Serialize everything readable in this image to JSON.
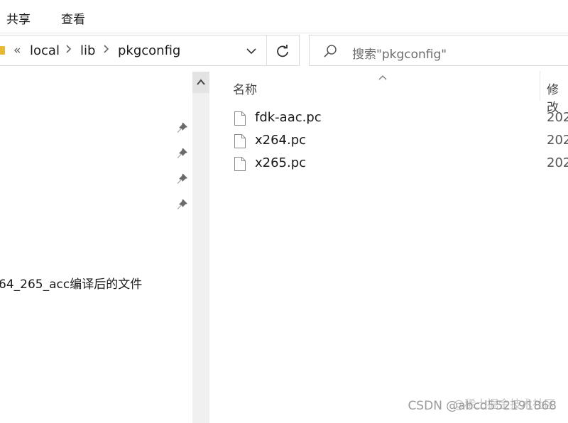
{
  "ribbon": {
    "tabs": [
      "共享",
      "查看"
    ]
  },
  "address_bar": {
    "overflow": "«",
    "breadcrumbs": [
      "local",
      "lib",
      "pkgconfig"
    ],
    "icons": [
      "folder-icon",
      "chevron-right-icon",
      "chevron-down-icon",
      "refresh-icon"
    ]
  },
  "search": {
    "placeholder": "搜索\"pkgconfig\"",
    "icon": "search-icon"
  },
  "nav_pane": {
    "pinned_count": 4,
    "item_text": "64_265_acc编译后的文件"
  },
  "columns": {
    "name": "名称",
    "modified": "修改"
  },
  "files": [
    {
      "name": "fdk-aac.pc",
      "date": "202"
    },
    {
      "name": "x264.pc",
      "date": "202"
    },
    {
      "name": "x265.pc",
      "date": "202"
    }
  ],
  "watermark": {
    "line1": "@稀土掘金技术社区",
    "line2": "CSDN @abcd552191868"
  },
  "colors": {
    "folder": "#e8b936",
    "border": "#d9d9d9",
    "scrollbar": "#f0f0f0"
  }
}
